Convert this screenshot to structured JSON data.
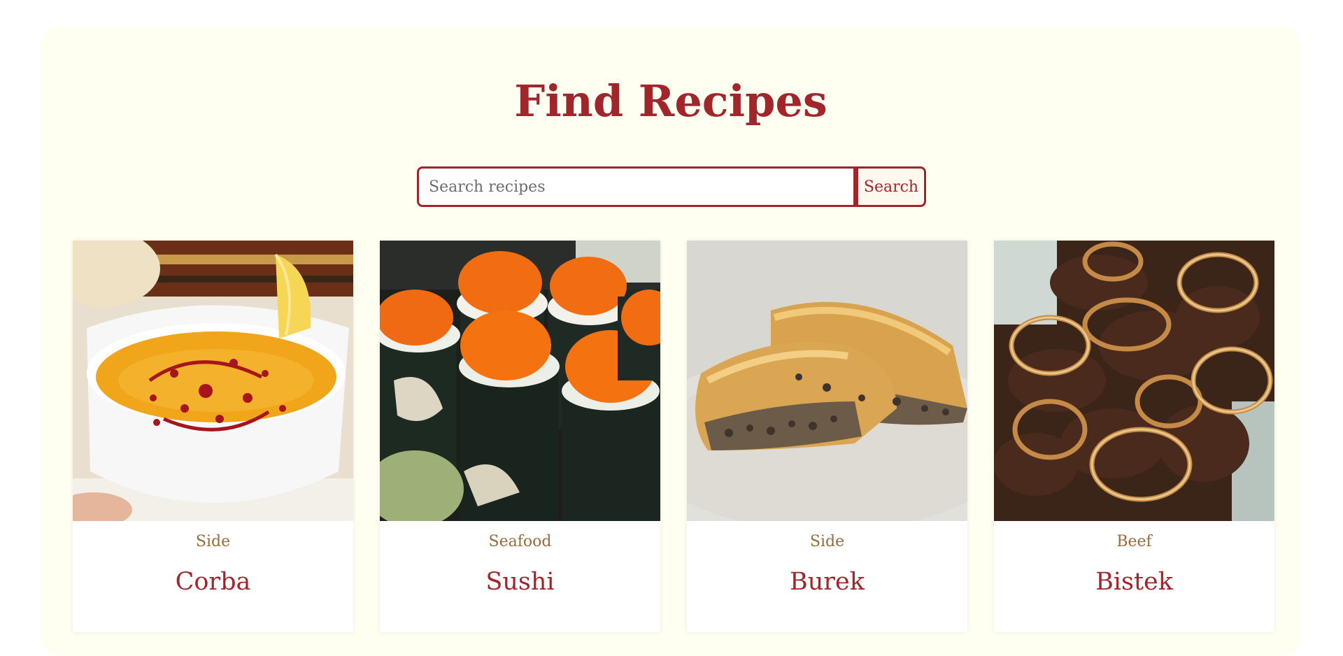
{
  "header": {
    "title": "Find Recipes"
  },
  "search": {
    "placeholder": "Search recipes",
    "value": "",
    "button_label": "Search"
  },
  "colors": {
    "accent": "#a1262b",
    "panel_bg": "#fefff0",
    "category": "#9a6a3a"
  },
  "recipes": [
    {
      "category": "Side",
      "name": "Corba",
      "image": "lentil-soup-photo"
    },
    {
      "category": "Seafood",
      "name": "Sushi",
      "image": "sushi-rolls-photo"
    },
    {
      "category": "Side",
      "name": "Burek",
      "image": "burek-pastry-photo"
    },
    {
      "category": "Beef",
      "name": "Bistek",
      "image": "beef-with-onions-photo"
    }
  ]
}
